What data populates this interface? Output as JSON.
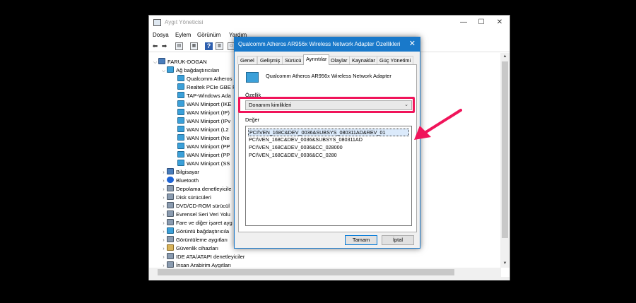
{
  "main_window": {
    "title": "Aygıt Yöneticisi",
    "menu": [
      "Dosya",
      "Eylem",
      "Görünüm",
      "Yardım"
    ],
    "tree": {
      "root": "FARUK-DOGAN",
      "network_group": "Ağ bağdaştırıcıları",
      "network_items": [
        "Qualcomm Atheros",
        "Realtek PCIe GBE F",
        "TAP-Windows Ada",
        "WAN Miniport (IKE",
        "WAN Miniport (IP)",
        "WAN Miniport (IPv",
        "WAN Miniport (L2",
        "WAN Miniport (Ne",
        "WAN Miniport (PP",
        "WAN Miniport (PP",
        "WAN Miniport (SS"
      ],
      "categories": [
        "Bilgisayar",
        "Bluetooth",
        "Depolama denetleyicile",
        "Disk sürücüleri",
        "DVD/CD-ROM sürücül",
        "Evrensel Seri Veri Yolu",
        "Fare ve diğer işaret ayg",
        "Görüntü bağdaştırıcıla",
        "Görüntüleme aygıtları",
        "Güvenlik cihazları",
        "IDE ATA/ATAPI denetleyiciler",
        "İnsan Arabirim Aygıtları"
      ]
    }
  },
  "dialog": {
    "title": "Qualcomm Atheros AR956x Wireless Network Adapter Özellikleri",
    "tabs": [
      "Genel",
      "Gelişmiş",
      "Sürücü",
      "Ayrıntılar",
      "Olaylar",
      "Kaynaklar",
      "Güç Yönetimi"
    ],
    "active_tab": "Ayrıntılar",
    "device_name": "Qualcomm Atheros AR956x Wireless Network Adapter",
    "property_label": "Özellik",
    "property_value": "Donanım kimlikleri",
    "value_label": "Değer",
    "values": [
      "PCI\\VEN_168C&DEV_0036&SUBSYS_080311AD&REV_01",
      "PCI\\VEN_168C&DEV_0036&SUBSYS_080311AD",
      "PCI\\VEN_168C&DEV_0036&CC_028000",
      "PCI\\VEN_168C&DEV_0036&CC_0280"
    ],
    "ok_label": "Tamam",
    "cancel_label": "İptal"
  },
  "colors": {
    "accent": "#1979ca",
    "highlight": "#f0145a"
  }
}
